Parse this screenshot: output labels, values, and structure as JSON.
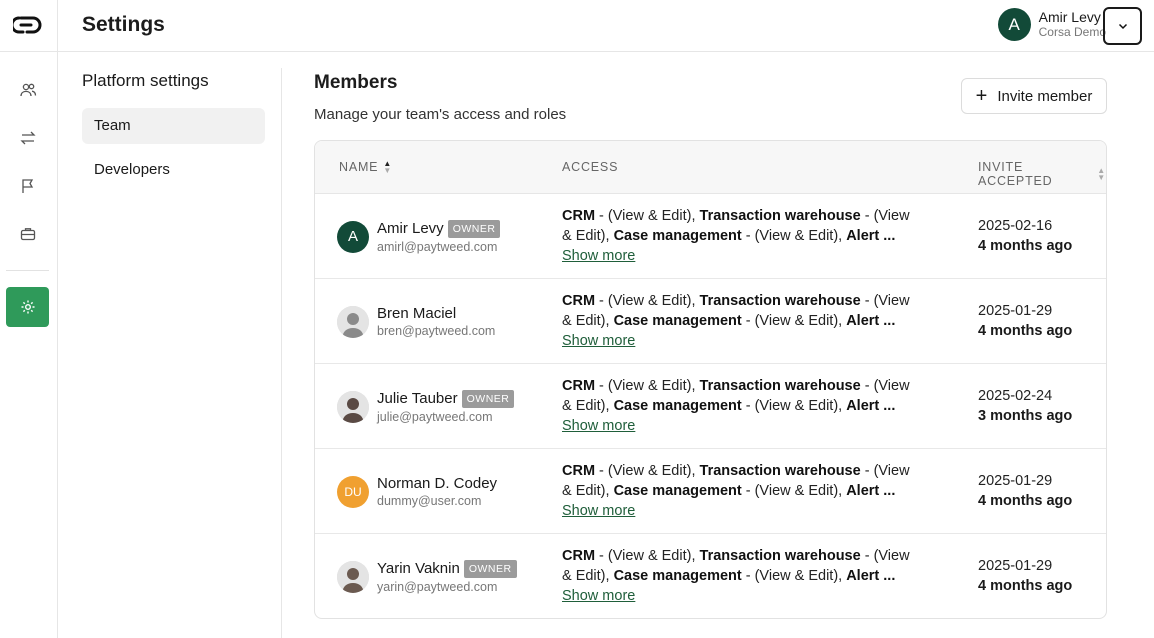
{
  "header": {
    "title": "Settings"
  },
  "user": {
    "initial": "A",
    "name": "Amir Levy",
    "org": "Corsa Demo"
  },
  "rail": {
    "icons": [
      "users-icon",
      "transfer-icon",
      "flag-icon",
      "briefcase-icon",
      "settings-icon"
    ]
  },
  "settings_nav": {
    "title": "Platform settings",
    "items": [
      {
        "label": "Team"
      },
      {
        "label": "Developers"
      }
    ]
  },
  "members": {
    "title": "Members",
    "subtitle": "Manage your team's access and roles",
    "invite_label": "Invite member",
    "columns": [
      "NAME",
      "ACCESS",
      "INVITE ACCEPTED"
    ],
    "show_more": "Show more",
    "access_parts": {
      "crm": "CRM",
      "crm_perm": " - (View & Edit), ",
      "tw": "Transaction warehouse",
      "tw_perm": " - (View & Edit), ",
      "cm": "Case management",
      "cm_perm": " - (View & Edit), ",
      "alert": "Alert",
      "ellipsis": " ..."
    },
    "rows": [
      {
        "name": "Amir Levy",
        "email": "amirl@paytweed.com",
        "badge": "OWNER",
        "avatar": "A",
        "date": "2025-02-16",
        "ago": "4 months ago"
      },
      {
        "name": "Bren Maciel",
        "email": "bren@paytweed.com",
        "badge": "",
        "avatar": "",
        "date": "2025-01-29",
        "ago": "4 months ago"
      },
      {
        "name": "Julie Tauber",
        "email": "julie@paytweed.com",
        "badge": "OWNER",
        "avatar": "",
        "date": "2025-02-24",
        "ago": "3 months ago"
      },
      {
        "name": "Norman D. Codey",
        "email": "dummy@user.com",
        "badge": "",
        "avatar": "DU",
        "date": "2025-01-29",
        "ago": "4 months ago"
      },
      {
        "name": "Yarin Vaknin",
        "email": "yarin@paytweed.com",
        "badge": "OWNER",
        "avatar": "",
        "date": "2025-01-29",
        "ago": "4 months ago"
      }
    ]
  },
  "colors": {
    "accent": "#2f9a5a",
    "avatar_dark": "#124a38",
    "link": "#1f5e3a",
    "du_avatar": "#f0a030",
    "badge": "#9b9b9b"
  }
}
